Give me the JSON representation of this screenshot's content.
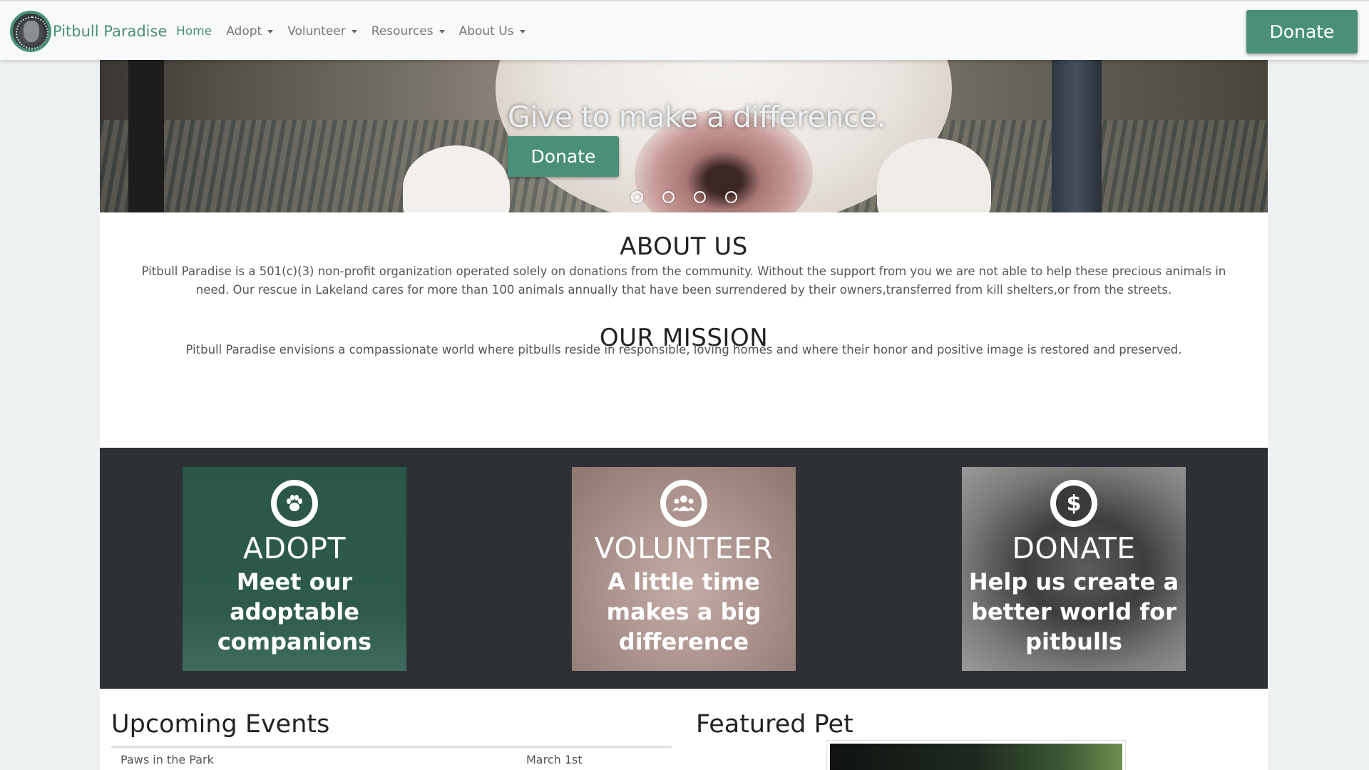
{
  "navbar": {
    "brand": "Pitbull Paradise",
    "links": [
      {
        "label": "Home",
        "dropdown": false
      },
      {
        "label": "Adopt",
        "dropdown": true
      },
      {
        "label": "Volunteer",
        "dropdown": true
      },
      {
        "label": "Resources",
        "dropdown": true
      },
      {
        "label": "About Us",
        "dropdown": true
      }
    ],
    "donate_label": "Donate"
  },
  "hero": {
    "caption": "Give to make a difference.",
    "button_label": "Donate",
    "slide_count": 4,
    "active_slide": 1
  },
  "about": {
    "heading": "ABOUT US",
    "text": "Pitbull Paradise is a 501(c)(3) non-profit organization operated solely on donations from the community. Without the support from you we are not able to help these precious animals in need. Our rescue in Lakeland cares for more than 100 animals annually that have been surrendered by their owners,transferred from kill shelters,or from the streets.",
    "mission_heading": "OUR MISSION",
    "mission_text": "Pitbull Paradise envisions a compassionate world where pitbulls reside in responsible, loving homes and where their honor and positive image is restored and preserved."
  },
  "cards": [
    {
      "title": "ADOPT",
      "subtitle": "Meet our adoptable companions",
      "icon": "paw-icon"
    },
    {
      "title": "VOLUNTEER",
      "subtitle": "A little time makes a big difference",
      "icon": "people-icon"
    },
    {
      "title": "DONATE",
      "subtitle": "Help us create a better world for pitbulls",
      "icon": "dollar-icon"
    }
  ],
  "events": {
    "heading": "Upcoming Events",
    "rows": [
      {
        "name": "Paws in the Park",
        "date": "March 1st"
      }
    ]
  },
  "featured": {
    "heading": "Featured Pet"
  },
  "colors": {
    "brand": "#4a9079",
    "navbar_bg": "#f8f9fa",
    "cards_bg": "#2d3035"
  }
}
